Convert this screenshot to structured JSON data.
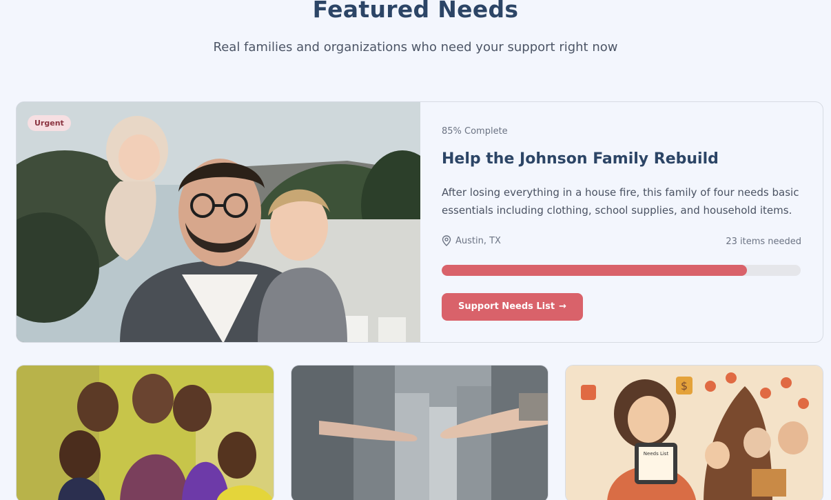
{
  "header": {
    "title": "Featured Needs",
    "subtitle": "Real families and organizations who need your support right now"
  },
  "featured": {
    "badge": "Urgent",
    "progress_label": "85% Complete",
    "progress_value": 0.85,
    "title": "Help the Johnson Family Rebuild",
    "description": "After losing everything in a house fire, this family of four needs basic essentials including clothing, school supplies, and household items.",
    "location": "Austin, TX",
    "items_needed": "23 items needed",
    "cta_label": "Support Needs List",
    "cta_icon": "arrow-right-icon",
    "location_icon": "map-pin-icon"
  },
  "cards": [
    {
      "image": "children-group-photo"
    },
    {
      "image": "reaching-hands-photo"
    },
    {
      "image": "family-illustration",
      "illustration_text": "Needs List"
    }
  ],
  "colors": {
    "accent": "#d9626a",
    "heading": "#2c4566",
    "background": "#f3f6fd",
    "badge_bg": "#f6dfe2"
  }
}
